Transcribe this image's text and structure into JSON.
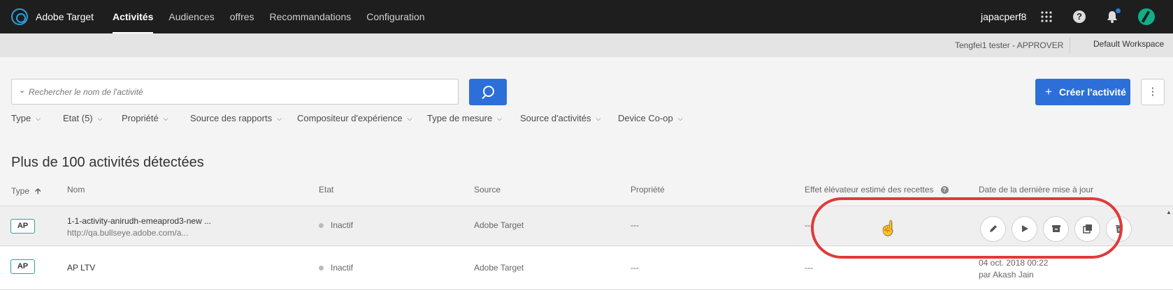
{
  "header": {
    "app_title": "Adobe Target",
    "nav": [
      "Activités",
      "Audiences",
      "offres",
      "Recommandations",
      "Configuration"
    ],
    "user": "japacperf8"
  },
  "subbar": {
    "tester": "Tengfei1 tester - APPROVER",
    "workspace": "Default Workspace"
  },
  "search": {
    "placeholder": "Rechercher le nom de l'activité"
  },
  "create_button": "Créer l'activité",
  "filters": [
    "Type",
    "Etat (5)",
    "Propriété",
    "Source des rapports",
    "Compositeur d'expérience",
    "Type de mesure",
    "Source d'activités",
    "Device Co-op"
  ],
  "count_title": "Plus de 100 activités détectées",
  "columns": [
    "Type",
    "Nom",
    "Etat",
    "Source",
    "Propriété",
    "Effet élévateur estimé des recettes",
    "Date de la dernière mise à jour"
  ],
  "rows": [
    {
      "type": "AP",
      "name": "1-1-activity-anirudh-emeaprod3-new ...",
      "url": "http://qa.bullseye.adobe.com/a...",
      "status": "Inactif",
      "source": "Adobe Target",
      "property": "---",
      "lift": "---"
    },
    {
      "type": "AP",
      "name": "AP LTV",
      "status": "Inactif",
      "source": "Adobe Target",
      "property": "---",
      "lift": "---",
      "date": "04 oct. 2018 00:22",
      "by": "par Akash Jain"
    }
  ],
  "colors": {
    "accent": "#2d6fd8",
    "highlight": "#e03a3a",
    "badge_border": "#2aa59a"
  },
  "icons": [
    "logo-icon",
    "apps-grid-icon",
    "help-icon",
    "bell-icon",
    "avatar",
    "search-icon",
    "more-icon",
    "sort-up-icon",
    "edit-icon",
    "play-icon",
    "archive-icon",
    "copy-icon",
    "delete-icon",
    "cursor-hand-icon"
  ]
}
